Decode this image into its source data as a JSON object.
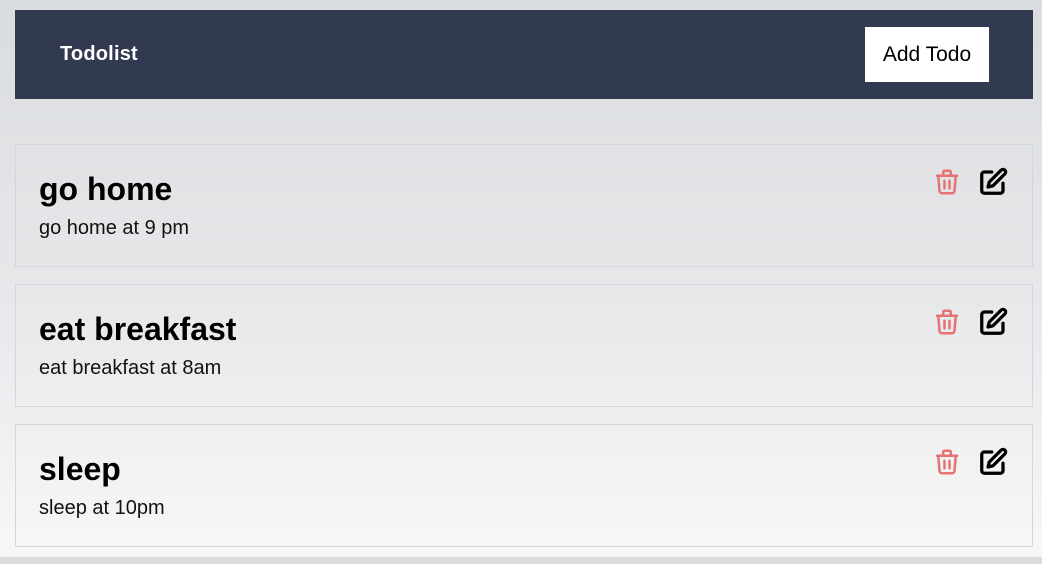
{
  "header": {
    "brand": "Todolist",
    "add_button_label": "Add Todo"
  },
  "colors": {
    "navbar": "#323a51",
    "delete_icon": "#e57373",
    "edit_icon": "#000000"
  },
  "todos": [
    {
      "title": "go home",
      "description": "go home at 9 pm",
      "delete_icon": "trash-icon",
      "edit_icon": "edit-icon"
    },
    {
      "title": "eat breakfast",
      "description": "eat breakfast at 8am",
      "delete_icon": "trash-icon",
      "edit_icon": "edit-icon"
    },
    {
      "title": "sleep",
      "description": "sleep at 10pm",
      "delete_icon": "trash-icon",
      "edit_icon": "edit-icon"
    }
  ]
}
